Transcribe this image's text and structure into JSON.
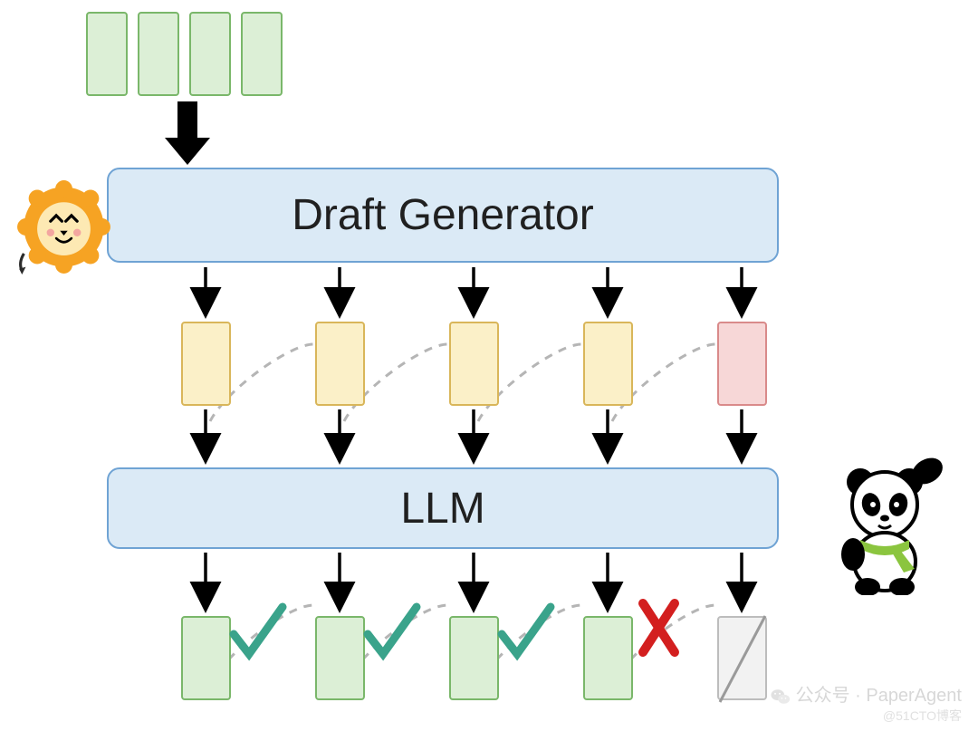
{
  "draft_generator": {
    "label": "Draft Generator"
  },
  "llm": {
    "label": "LLM"
  },
  "input_tokens": {
    "count": 4,
    "color": "green"
  },
  "draft_tokens": [
    {
      "idx": 0,
      "color": "yellow"
    },
    {
      "idx": 1,
      "color": "yellow"
    },
    {
      "idx": 2,
      "color": "yellow"
    },
    {
      "idx": 3,
      "color": "yellow"
    },
    {
      "idx": 4,
      "color": "red"
    }
  ],
  "output_tokens": [
    {
      "idx": 0,
      "status": "accepted",
      "color": "green",
      "mark": "check"
    },
    {
      "idx": 1,
      "status": "accepted",
      "color": "green",
      "mark": "check"
    },
    {
      "idx": 2,
      "status": "accepted",
      "color": "green",
      "mark": "check"
    },
    {
      "idx": 3,
      "status": "rejected",
      "color": "green",
      "mark": "cross"
    },
    {
      "idx": 4,
      "status": "discarded",
      "color": "grey",
      "mark": "slash"
    }
  ],
  "arrows": {
    "kind_in_to_draft": "solid-thick",
    "kind_tokens": "solid",
    "kind_feedback": "dashed-grey"
  },
  "watermark": {
    "line1": "公众号 · PaperAgent",
    "line2": "@51CTO博客"
  },
  "colors": {
    "green_fill": "#dcefd6",
    "green_stroke": "#7ab76a",
    "yellow_fill": "#fbf0c8",
    "yellow_stroke": "#d9b65a",
    "red_fill": "#f7d7d7",
    "red_stroke": "#d98a8a",
    "grey_fill": "#f2f2f2",
    "grey_stroke": "#bdbdbd",
    "blue_fill": "#dbeaf6",
    "blue_stroke": "#6fa3d4",
    "check": "#3aa38b",
    "cross": "#d31f1f"
  }
}
